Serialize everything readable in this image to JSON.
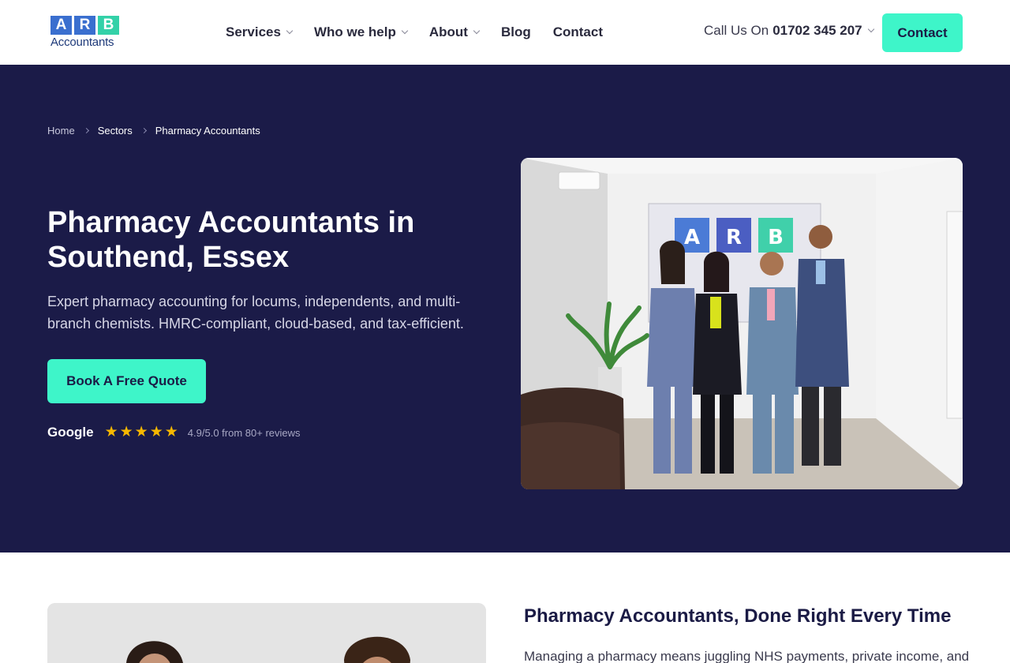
{
  "brand": {
    "letters": [
      "A",
      "R",
      "B"
    ],
    "letter_colors": [
      "#3a6fcf",
      "#3a6fcf",
      "#33d1a8"
    ],
    "wordmark": "Accountants"
  },
  "nav": {
    "items": [
      {
        "label": "Services",
        "dropdown": true
      },
      {
        "label": "Who we help",
        "dropdown": true
      },
      {
        "label": "About",
        "dropdown": true
      },
      {
        "label": "Blog",
        "dropdown": false
      },
      {
        "label": "Contact",
        "dropdown": false
      }
    ],
    "call_prefix": "Call Us On",
    "phone": "01702 345 207",
    "contact_button": "Contact"
  },
  "breadcrumb": [
    "Home",
    "Sectors",
    "Pharmacy Accountants"
  ],
  "hero": {
    "title": "Pharmacy Accountants in Southend, Essex",
    "subtitle": "Expert pharmacy accounting for locums, independents, and multi-branch chemists. HMRC-compliant, cloud-based, and tax-efficient.",
    "cta": "Book A Free Quote",
    "review_source": "Google",
    "rating_stars": 5,
    "review_text": "4.9/5.0 from 80+ reviews"
  },
  "section": {
    "title": "Pharmacy Accountants, Done Right Every Time",
    "body": "Managing a pharmacy means juggling NHS payments, private income, and"
  },
  "colors": {
    "hero_bg": "#1b1b48",
    "accent": "#3ef5c9",
    "star": "#f7b800"
  }
}
